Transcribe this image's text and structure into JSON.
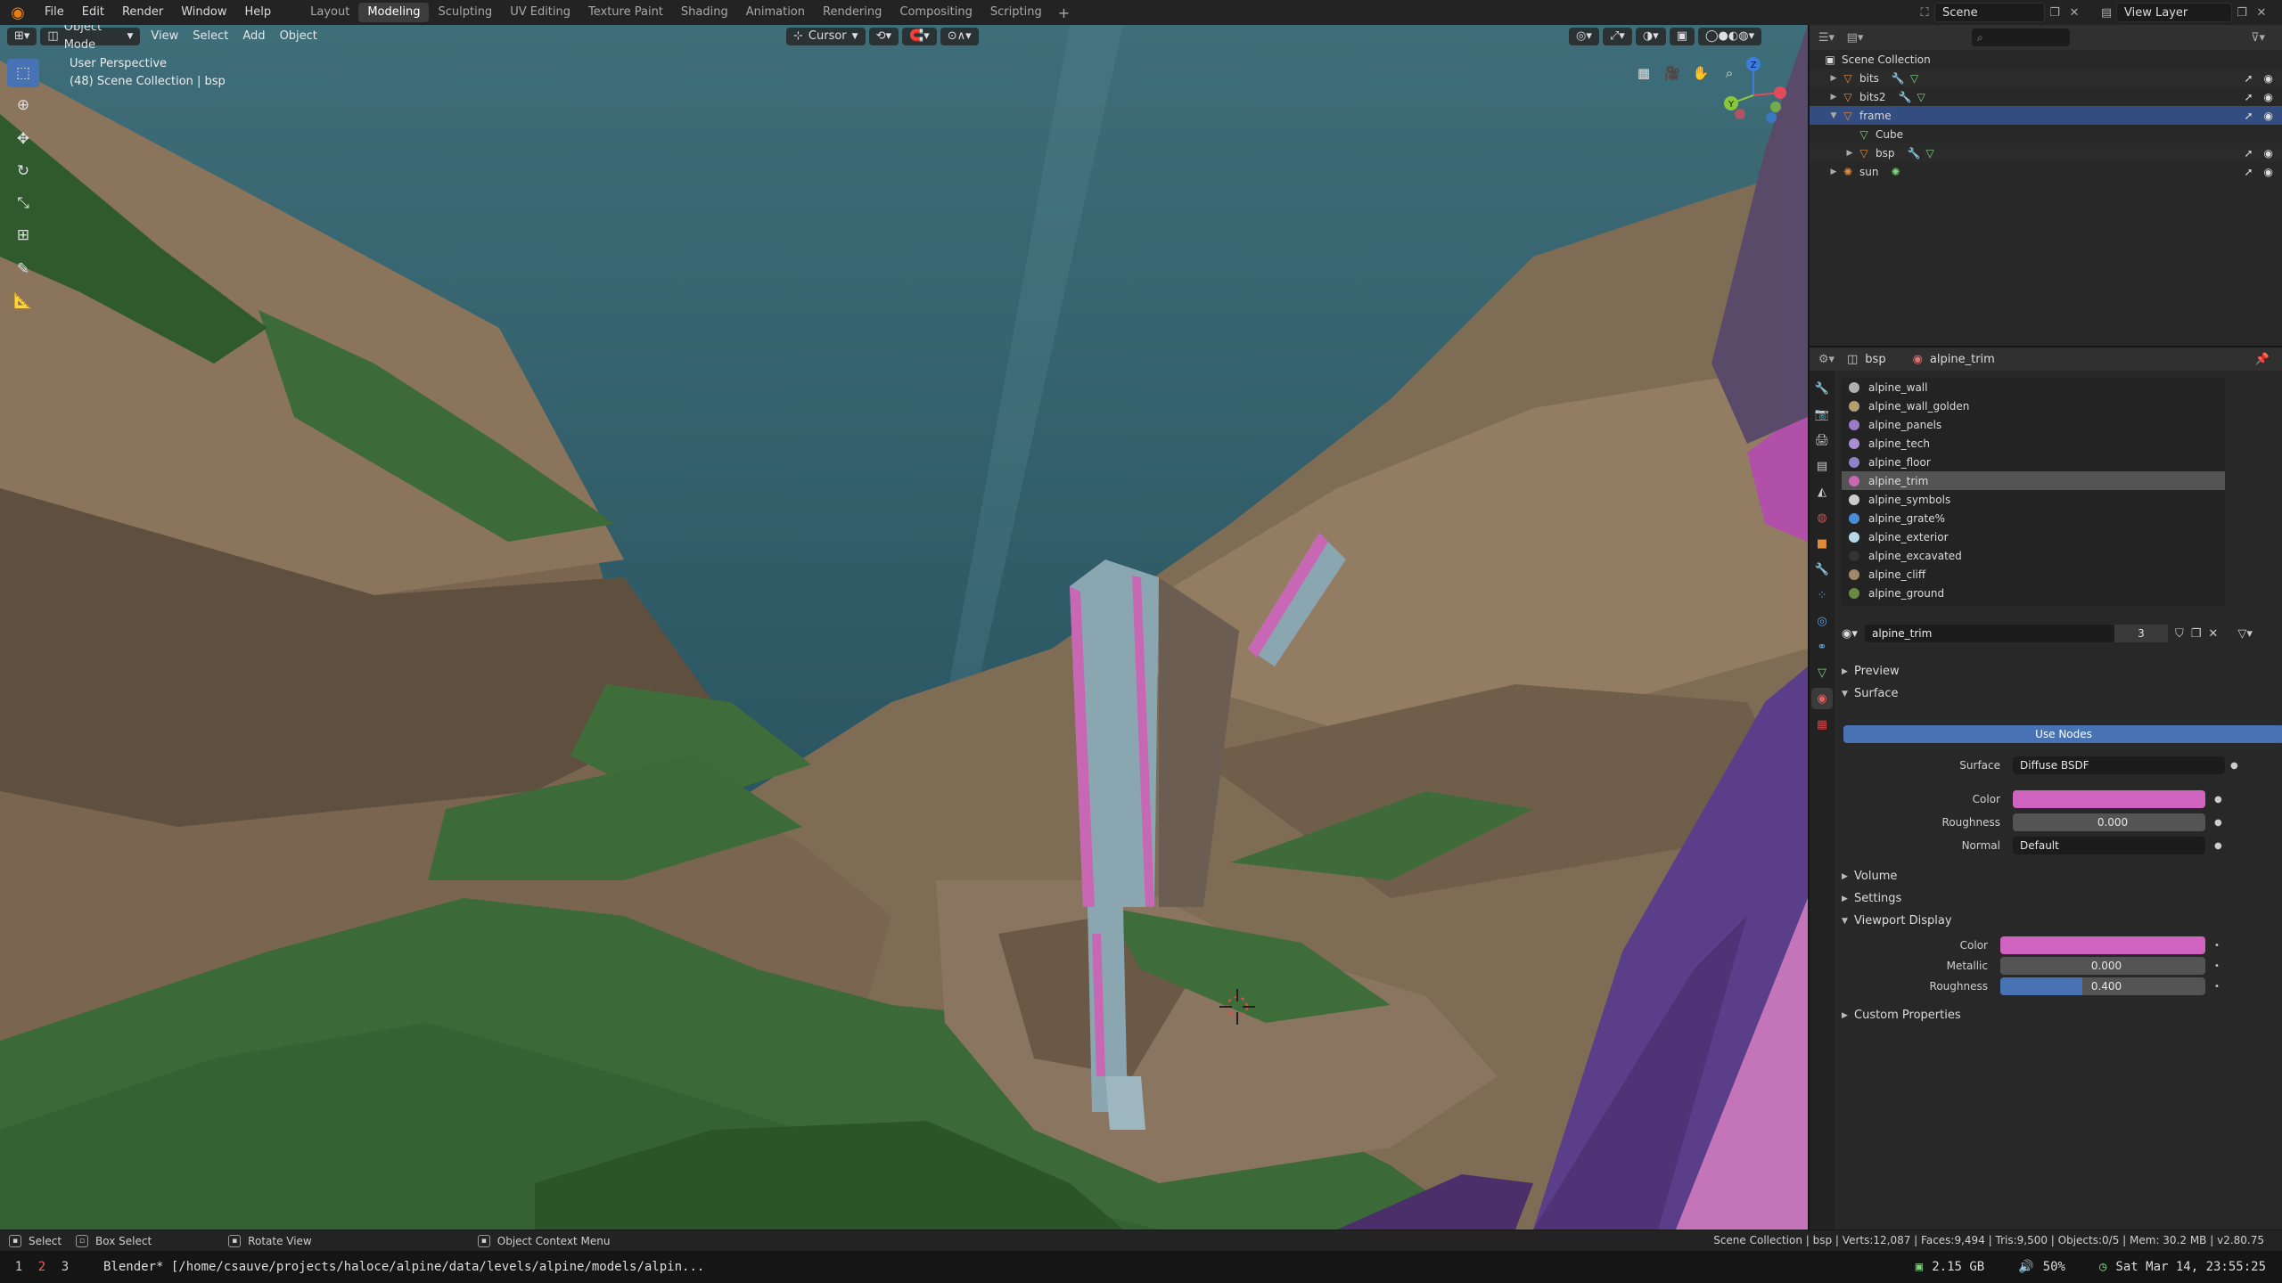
{
  "topbar": {
    "menus": [
      "File",
      "Edit",
      "Render",
      "Window",
      "Help"
    ],
    "workspaces": [
      "Layout",
      "Modeling",
      "Sculpting",
      "UV Editing",
      "Texture Paint",
      "Shading",
      "Animation",
      "Rendering",
      "Compositing",
      "Scripting"
    ],
    "active_workspace": "Modeling",
    "add_label": "+",
    "scene_name": "Scene",
    "view_layer": "View Layer"
  },
  "viewport": {
    "mode": "Object Mode",
    "menus": [
      "View",
      "Select",
      "Add",
      "Object"
    ],
    "pivot": "Cursor",
    "info_line1": "User Perspective",
    "info_line2": "(48) Scene Collection | bsp",
    "gizmo_axes": {
      "x": "X",
      "y": "Y",
      "z": "Z"
    },
    "colors": {
      "sky": "#2f5a66",
      "rock": "#7d6b54",
      "grass": "#3e6b3a",
      "trim": "#c868b4",
      "purple": "#5a3d88"
    }
  },
  "outliner": {
    "root": "Scene Collection",
    "rows": [
      {
        "name": "bits",
        "icon": "object-icon",
        "level": 1,
        "mods": true
      },
      {
        "name": "bits2",
        "icon": "object-icon",
        "level": 1,
        "mods": true
      },
      {
        "name": "frame",
        "icon": "object-icon",
        "level": 1,
        "mods": false,
        "selected": true
      },
      {
        "name": "Cube",
        "icon": "mesh-icon",
        "level": 2,
        "mods": false
      },
      {
        "name": "bsp",
        "icon": "object-icon",
        "level": 2,
        "mods": true
      },
      {
        "name": "sun",
        "icon": "light-icon",
        "level": 1,
        "mods": false
      }
    ]
  },
  "properties": {
    "object": "bsp",
    "material": "alpine_trim",
    "materials": [
      {
        "name": "alpine_wall",
        "color": "#b0b0b0"
      },
      {
        "name": "alpine_wall_golden",
        "color": "#b0a070"
      },
      {
        "name": "alpine_panels",
        "color": "#9a7cc8"
      },
      {
        "name": "alpine_tech",
        "color": "#a88fd0"
      },
      {
        "name": "alpine_floor",
        "color": "#9080c8"
      },
      {
        "name": "alpine_trim",
        "color": "#c868b4",
        "selected": true
      },
      {
        "name": "alpine_symbols",
        "color": "#cccccc"
      },
      {
        "name": "alpine_grate%",
        "color": "#4a8ed8"
      },
      {
        "name": "alpine_exterior",
        "color": "#b8d8e8"
      },
      {
        "name": "alpine_excavated",
        "color": "#333333"
      },
      {
        "name": "alpine_cliff",
        "color": "#a08868"
      },
      {
        "name": "alpine_ground",
        "color": "#6a8a40"
      }
    ],
    "slot_name": "alpine_trim",
    "slot_users": "3",
    "sections": {
      "preview": "Preview",
      "surface": "Surface",
      "volume": "Volume",
      "settings": "Settings",
      "viewport_display": "Viewport Display",
      "custom": "Custom Properties"
    },
    "use_nodes": "Use Nodes",
    "surface": {
      "surface_label": "Surface",
      "surface_value": "Diffuse BSDF",
      "color_label": "Color",
      "color_value": "#d063c0",
      "roughness_label": "Roughness",
      "roughness_value": "0.000",
      "normal_label": "Normal",
      "normal_value": "Default"
    },
    "viewport_display": {
      "color_label": "Color",
      "color_value": "#d063c0",
      "metallic_label": "Metallic",
      "metallic_value": "0.000",
      "metallic_fraction": 0,
      "roughness_label": "Roughness",
      "roughness_value": "0.400",
      "roughness_fraction": 0.4
    }
  },
  "statusbar": {
    "select": "Select",
    "box_select": "Box Select",
    "rotate_view": "Rotate View",
    "context_menu": "Object Context Menu",
    "stats": "Scene Collection | bsp | Verts:12,087 | Faces:9,494 | Tris:9,500 | Objects:0/5 | Mem: 30.2 MB | v2.80.75"
  },
  "taskbar": {
    "workspaces": [
      "1",
      "2",
      "3"
    ],
    "current_ws": "2",
    "title": "Blender* [/home/csauve/projects/haloce/alpine/data/levels/alpine/models/alpin...",
    "disk": "2.15 GB",
    "volume": "50%",
    "datetime": "Sat Mar 14, 23:55:25"
  }
}
